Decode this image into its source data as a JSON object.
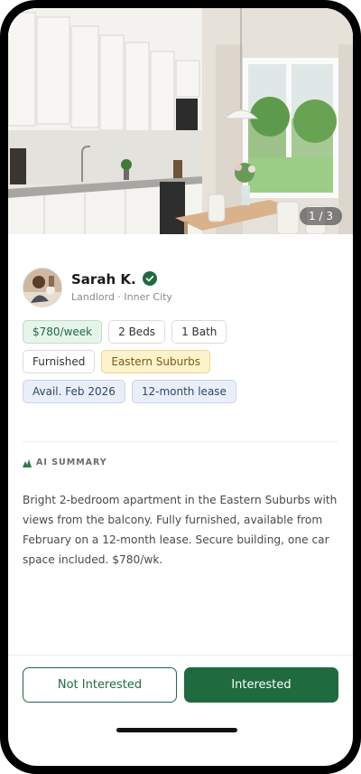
{
  "listing": {
    "photo_counter": "1 / 3"
  },
  "landlord": {
    "name": "Sarah K.",
    "subtitle": "Landlord · Inner City",
    "verified": true
  },
  "chips": {
    "row1": [
      "$780/week",
      "2 Beds",
      "1 Bath"
    ],
    "row2": [
      "Furnished",
      "Eastern Suburbs"
    ],
    "row3": [
      "Avail. Feb 2026",
      "12-month lease"
    ]
  },
  "ai_summary": {
    "label": "AI SUMMARY",
    "text": "Bright 2-bedroom apartment in the Eastern Suburbs with views from the balcony. Fully furnished, available from February on a 12-month lease. Secure building, one car space included. $780/wk."
  },
  "actions": {
    "not_interested": "Not Interested",
    "interested": "Interested"
  },
  "colors": {
    "accent": "#1f6b3f",
    "chip_green_bg": "#e7f4ec",
    "chip_yellow_bg": "#fcf2cc",
    "chip_blue_bg": "#e9eef8"
  }
}
